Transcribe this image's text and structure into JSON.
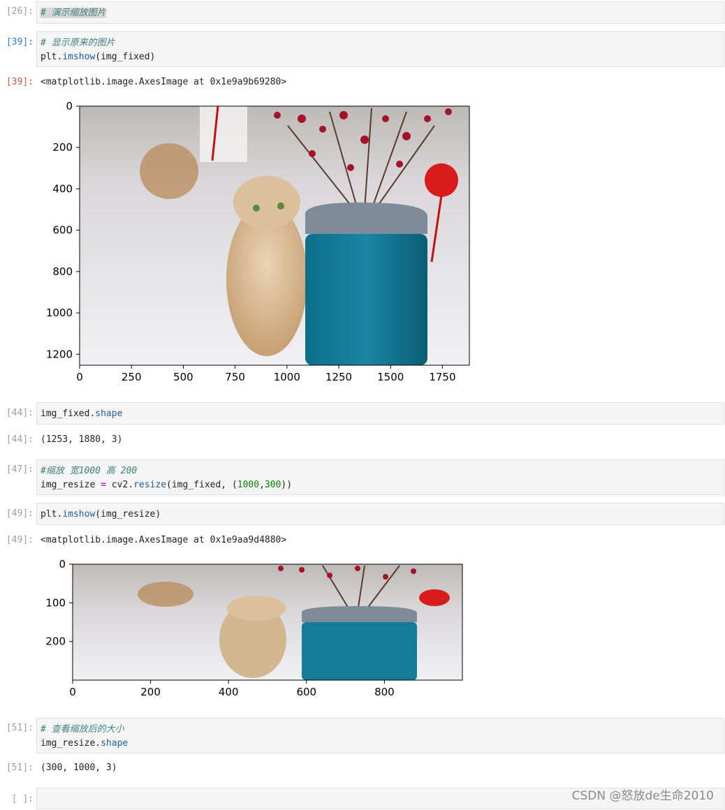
{
  "cells": [
    {
      "prompt": "[26]:",
      "lines": [
        "# 演示缩放图片"
      ]
    },
    {
      "prompt": "[39]:",
      "lines": [
        "# 显示原来的图片",
        "plt.imshow(img_fixed)"
      ]
    },
    {
      "prompt": "[44]:",
      "lines": [
        "img_fixed.shape"
      ]
    },
    {
      "prompt": "[47]:",
      "lines": [
        "#缩放 宽1000 高 200",
        "img_resize = cv2.resize(img_fixed, (1000,300))"
      ]
    },
    {
      "prompt": "[49]:",
      "lines": [
        "plt.imshow(img_resize)"
      ]
    },
    {
      "prompt": "[51]:",
      "lines": [
        "# 查看缩放后的大小",
        "img_resize.shape"
      ]
    },
    {
      "prompt": "[ ]:",
      "lines": [
        ""
      ]
    }
  ],
  "outputs": [
    {
      "prompt": "[39]:",
      "text": "<matplotlib.image.AxesImage at 0x1e9a9b69280>"
    },
    {
      "prompt": "[44]:",
      "text": "(1253, 1880, 3)"
    },
    {
      "prompt": "[49]:",
      "text": "<matplotlib.image.AxesImage at 0x1e9aa9d4880>"
    },
    {
      "prompt": "[51]:",
      "text": "(300, 1000, 3)"
    }
  ],
  "chart_data": [
    {
      "type": "image",
      "xticks": [
        "0",
        "250",
        "500",
        "750",
        "1000",
        "1250",
        "1500",
        "1750"
      ],
      "yticks": [
        "0",
        "200",
        "400",
        "600",
        "800",
        "1000",
        "1200"
      ],
      "xlim": [
        0,
        1880
      ],
      "ylim": [
        1253,
        0
      ]
    },
    {
      "type": "image",
      "xticks": [
        "0",
        "200",
        "400",
        "600",
        "800"
      ],
      "yticks": [
        "0",
        "100",
        "200"
      ],
      "xlim": [
        0,
        1000
      ],
      "ylim": [
        300,
        0
      ]
    }
  ],
  "watermark": "CSDN @怒放de生命2010"
}
